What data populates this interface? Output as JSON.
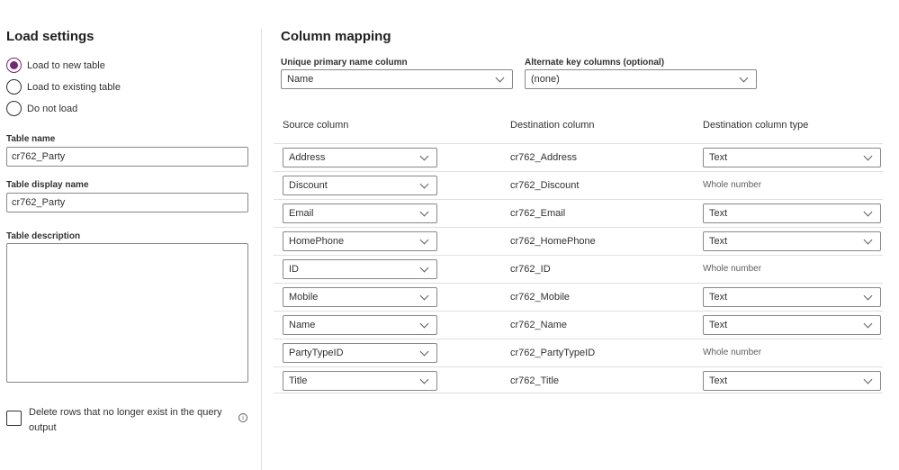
{
  "load_settings": {
    "title": "Load settings",
    "options": [
      {
        "label": "Load to new table",
        "selected": true
      },
      {
        "label": "Load to existing table",
        "selected": false
      },
      {
        "label": "Do not load",
        "selected": false
      }
    ],
    "table_name_label": "Table name",
    "table_name": "cr762_Party",
    "display_name_label": "Table display name",
    "display_name": "cr762_Party",
    "description_label": "Table description",
    "description": "",
    "delete_rows_label": "Delete rows that no longer exist in the query output",
    "delete_rows_checked": false,
    "info_icon": "info-icon"
  },
  "column_mapping": {
    "title": "Column mapping",
    "primary_label": "Unique primary name column",
    "primary_value": "Name",
    "alternate_label": "Alternate key columns (optional)",
    "alternate_value": "(none)",
    "headers": {
      "source": "Source column",
      "destination": "Destination column",
      "type": "Destination column type"
    },
    "rows": [
      {
        "source": "Address",
        "destination": "cr762_Address",
        "type": "Text",
        "editable": true
      },
      {
        "source": "Discount",
        "destination": "cr762_Discount",
        "type": "Whole number",
        "editable": false
      },
      {
        "source": "Email",
        "destination": "cr762_Email",
        "type": "Text",
        "editable": true
      },
      {
        "source": "HomePhone",
        "destination": "cr762_HomePhone",
        "type": "Text",
        "editable": true
      },
      {
        "source": "ID",
        "destination": "cr762_ID",
        "type": "Whole number",
        "editable": false
      },
      {
        "source": "Mobile",
        "destination": "cr762_Mobile",
        "type": "Text",
        "editable": true
      },
      {
        "source": "Name",
        "destination": "cr762_Name",
        "type": "Text",
        "editable": true
      },
      {
        "source": "PartyTypeID",
        "destination": "cr762_PartyTypeID",
        "type": "Whole number",
        "editable": false
      },
      {
        "source": "Title",
        "destination": "cr762_Title",
        "type": "Text",
        "editable": true
      }
    ]
  },
  "colors": {
    "accent": "#742774"
  }
}
